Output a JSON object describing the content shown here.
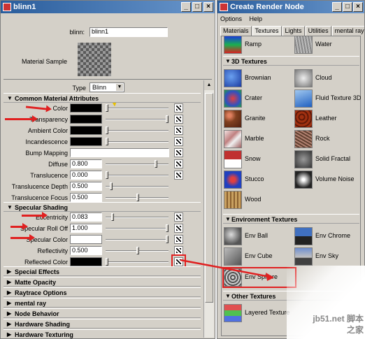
{
  "attr_editor": {
    "title": "blinn1",
    "name_label": "blinn:",
    "name_value": "blinn1",
    "material_sample_label": "Material Sample",
    "type_label": "Type",
    "type_value": "Blinn"
  },
  "common": {
    "header": "Common Material Attributes",
    "color_label": "Color",
    "transparency_label": "Transparency",
    "ambient_label": "Ambient Color",
    "incandescence_label": "Incandescence",
    "bump_label": "Bump Mapping",
    "diffuse_label": "Diffuse",
    "diffuse_value": "0.800",
    "translucence_label": "Translucence",
    "translucence_value": "0.000",
    "trans_depth_label": "Translucence Depth",
    "trans_depth_value": "0.500",
    "trans_focus_label": "Translucence Focus",
    "trans_focus_value": "0.500"
  },
  "specular": {
    "header": "Specular Shading",
    "eccentricity_label": "Eccentricity",
    "eccentricity_value": "0.083",
    "rolloff_label": "Specular Roll Off",
    "rolloff_value": "1.000",
    "spec_color_label": "Specular Color",
    "reflectivity_label": "Reflectivity",
    "reflectivity_value": "0.500",
    "reflected_label": "Reflected Color"
  },
  "collapsed_sections": [
    "Special Effects",
    "Matte Opacity",
    "Raytrace Options",
    "mental ray",
    "Node Behavior",
    "Hardware Shading",
    "Hardware Texturing"
  ],
  "render_node": {
    "title": "Create Render Node",
    "menu": [
      "Options",
      "Help"
    ],
    "tabs": [
      "Materials",
      "Textures",
      "Lights",
      "Utilities",
      "mental ray"
    ],
    "top_row": [
      "Ramp",
      "Water"
    ],
    "header_3d": "3D Textures",
    "textures_3d": [
      "Brownian",
      "Cloud",
      "Crater",
      "Fluid Texture 3D",
      "Granite",
      "Leather",
      "Marble",
      "Rock",
      "Snow",
      "Solid Fractal",
      "Stucco",
      "Volume Noise",
      "Wood"
    ],
    "header_env": "Environment Textures",
    "env": [
      "Env Ball",
      "Env Chrome",
      "Env Cube",
      "Env Sky",
      "Env Sphere"
    ],
    "header_other": "Other Textures",
    "other": [
      "Layered Texture"
    ]
  },
  "watermark": "jb51.net 脚本之家",
  "colors": {
    "accent": "#e02020",
    "titlebar": "#2a5d9c"
  }
}
